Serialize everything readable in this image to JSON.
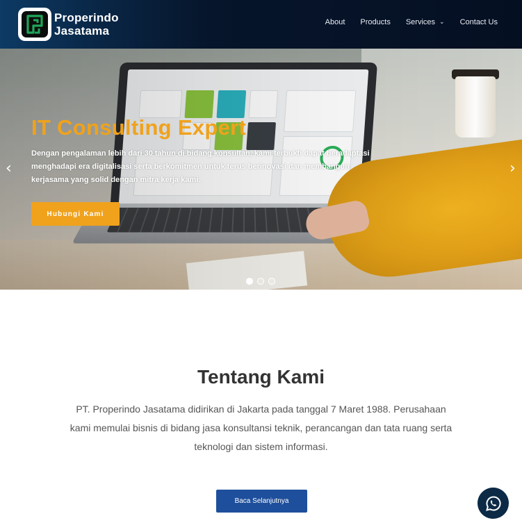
{
  "header": {
    "logo_line1": "Properindo",
    "logo_line2": "Jasatama",
    "nav": [
      {
        "label": "About"
      },
      {
        "label": "Products"
      },
      {
        "label": "Services"
      },
      {
        "label": "Contact Us"
      }
    ]
  },
  "hero": {
    "title": "IT Consulting Expert",
    "description": "Dengan pengalaman lebih dari 30 tahun di bidang konsultan, kami terbukti dapat beradaptasi menghadapi era digitalisasi serta berkomitmen untuk terus berinovasi dan membangun kerjasama yang solid dengan mitra kerja kami.",
    "button_label": "Hubungi Kami",
    "slides_total": 3,
    "active_slide": 1
  },
  "about": {
    "title": "Tentang Kami",
    "text": "PT. Properindo Jasatama didirikan di Jakarta pada tanggal 7 Maret 1988. Perusahaan kami memulai bisnis di bidang jasa konsultansi teknik, perancangan dan tata ruang serta teknologi dan sistem informasi.",
    "button_label": "Baca Selanjutnya"
  },
  "colors": {
    "accent": "#f0a21c",
    "primary_button": "#1e4f9c",
    "header_bg": "#050f22"
  },
  "icons": {
    "prev": "chevron-left-icon",
    "next": "chevron-right-icon",
    "services_dropdown": "chevron-down-icon",
    "floating": "whatsapp-chat-icon"
  }
}
